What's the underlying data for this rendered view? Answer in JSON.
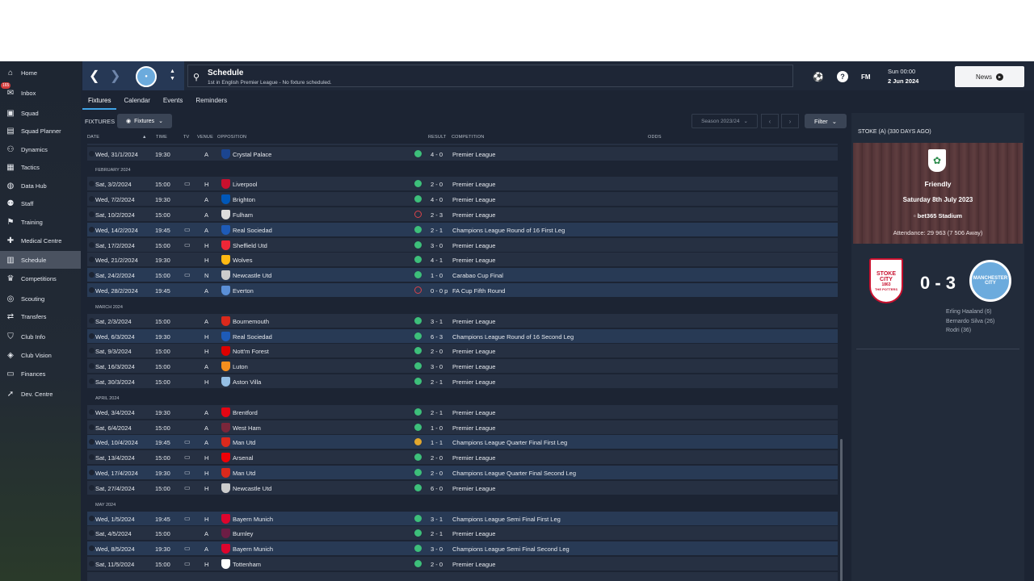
{
  "sidebar": {
    "items": [
      {
        "label": "Home",
        "icon": "home-icon"
      },
      {
        "label": "Inbox",
        "icon": "inbox-icon",
        "badge": "165"
      },
      {
        "label": "Squad",
        "icon": "shirt-icon"
      },
      {
        "label": "Squad Planner",
        "icon": "planner-icon"
      },
      {
        "label": "Dynamics",
        "icon": "dynamics-icon"
      },
      {
        "label": "Tactics",
        "icon": "tactics-icon"
      },
      {
        "label": "Data Hub",
        "icon": "data-hub-icon"
      },
      {
        "label": "Staff",
        "icon": "staff-icon"
      },
      {
        "label": "Training",
        "icon": "training-icon"
      },
      {
        "label": "Medical Centre",
        "icon": "medical-icon"
      },
      {
        "label": "Schedule",
        "icon": "calendar-icon",
        "active": true
      },
      {
        "label": "Competitions",
        "icon": "trophy-icon"
      },
      {
        "label": "Scouting",
        "icon": "scouting-icon"
      },
      {
        "label": "Transfers",
        "icon": "transfers-icon"
      },
      {
        "label": "Club Info",
        "icon": "club-info-icon"
      },
      {
        "label": "Club Vision",
        "icon": "club-vision-icon"
      },
      {
        "label": "Finances",
        "icon": "finances-icon"
      },
      {
        "label": "Dev. Centre",
        "icon": "dev-centre-icon"
      }
    ]
  },
  "header": {
    "title": "Schedule",
    "subtitle": "1st in English Premier League - No fixture scheduled.",
    "fm": "FM",
    "date_day": "Sun 00:00",
    "date_full": "2 Jun 2024",
    "news": "News"
  },
  "tabs": [
    "Fixtures",
    "Calendar",
    "Events",
    "Reminders"
  ],
  "toolbar": {
    "label": "FIXTURES",
    "view": "Fixtures",
    "season": "Season 2023/24",
    "filter": "Filter"
  },
  "columns": [
    "DATE",
    "TIME",
    "TV",
    "VENUE",
    "OPPOSITION",
    "RESULT",
    "COMPETITION",
    "ODDS"
  ],
  "colors": {
    "win": "#3dbf7a",
    "loss": "#d8434a",
    "draw": "#e2a72e",
    "accent": "#3fa3e6"
  },
  "fixtures": [
    {
      "type": "match",
      "date": "Wed, 31/1/2024",
      "time": "19:30",
      "tv": false,
      "venue": "A",
      "opp": "Crystal Palace",
      "crest": "#1b458f",
      "result": "4 - 0",
      "outcome": "win",
      "comp": "Premier League",
      "alt": false
    },
    {
      "type": "month",
      "label": "FEBRUARY 2024"
    },
    {
      "type": "match",
      "date": "Sat, 3/2/2024",
      "time": "15:00",
      "tv": true,
      "venue": "H",
      "opp": "Liverpool",
      "crest": "#c8102e",
      "result": "2 - 0",
      "outcome": "win",
      "comp": "Premier League",
      "alt": false
    },
    {
      "type": "match",
      "date": "Wed, 7/2/2024",
      "time": "19:30",
      "tv": false,
      "venue": "A",
      "opp": "Brighton",
      "crest": "#0057b8",
      "result": "4 - 0",
      "outcome": "win",
      "comp": "Premier League",
      "alt": false
    },
    {
      "type": "match",
      "date": "Sat, 10/2/2024",
      "time": "15:00",
      "tv": false,
      "venue": "A",
      "opp": "Fulham",
      "crest": "#dddddd",
      "result": "2 - 3",
      "outcome": "loss",
      "comp": "Premier League",
      "alt": false
    },
    {
      "type": "match",
      "date": "Wed, 14/2/2024",
      "time": "19:45",
      "tv": true,
      "venue": "A",
      "opp": "Real Sociedad",
      "crest": "#1e5bb8",
      "result": "2 - 1",
      "outcome": "win",
      "comp": "Champions League Round of 16  First Leg",
      "alt": true
    },
    {
      "type": "match",
      "date": "Sat, 17/2/2024",
      "time": "15:00",
      "tv": true,
      "venue": "H",
      "opp": "Sheffield Utd",
      "crest": "#ee2737",
      "result": "3 - 0",
      "outcome": "win",
      "comp": "Premier League",
      "alt": false
    },
    {
      "type": "match",
      "date": "Wed, 21/2/2024",
      "time": "19:30",
      "tv": false,
      "venue": "H",
      "opp": "Wolves",
      "crest": "#fdb913",
      "result": "4 - 1",
      "outcome": "win",
      "comp": "Premier League",
      "alt": false
    },
    {
      "type": "match",
      "date": "Sat, 24/2/2024",
      "time": "15:00",
      "tv": true,
      "venue": "N",
      "opp": "Newcastle Utd",
      "crest": "#cccccc",
      "result": "1 - 0",
      "outcome": "win",
      "comp": "Carabao Cup Final",
      "alt": true
    },
    {
      "type": "match",
      "date": "Wed, 28/2/2024",
      "time": "19:45",
      "tv": false,
      "venue": "A",
      "opp": "Everton",
      "crest": "#5b8fd6",
      "result": "0 - 0 p",
      "outcome": "loss",
      "comp": "FA Cup Fifth Round",
      "alt": true
    },
    {
      "type": "month",
      "label": "MARCH 2024"
    },
    {
      "type": "match",
      "date": "Sat, 2/3/2024",
      "time": "15:00",
      "tv": false,
      "venue": "A",
      "opp": "Bournemouth",
      "crest": "#da291c",
      "result": "3 - 1",
      "outcome": "win",
      "comp": "Premier League",
      "alt": false
    },
    {
      "type": "match",
      "date": "Wed, 6/3/2024",
      "time": "19:30",
      "tv": false,
      "venue": "H",
      "opp": "Real Sociedad",
      "crest": "#1e5bb8",
      "result": "6 - 3",
      "outcome": "win",
      "comp": "Champions League Round of 16  Second Leg",
      "alt": true
    },
    {
      "type": "match",
      "date": "Sat, 9/3/2024",
      "time": "15:00",
      "tv": false,
      "venue": "H",
      "opp": "Nott'm Forest",
      "crest": "#dd0000",
      "result": "2 - 0",
      "outcome": "win",
      "comp": "Premier League",
      "alt": false
    },
    {
      "type": "match",
      "date": "Sat, 16/3/2024",
      "time": "15:00",
      "tv": false,
      "venue": "A",
      "opp": "Luton",
      "crest": "#f78f1e",
      "result": "3 - 0",
      "outcome": "win",
      "comp": "Premier League",
      "alt": false
    },
    {
      "type": "match",
      "date": "Sat, 30/3/2024",
      "time": "15:00",
      "tv": false,
      "venue": "H",
      "opp": "Aston Villa",
      "crest": "#95bfe5",
      "result": "2 - 1",
      "outcome": "win",
      "comp": "Premier League",
      "alt": false
    },
    {
      "type": "month",
      "label": "APRIL 2024"
    },
    {
      "type": "match",
      "date": "Wed, 3/4/2024",
      "time": "19:30",
      "tv": false,
      "venue": "A",
      "opp": "Brentford",
      "crest": "#e30613",
      "result": "2 - 1",
      "outcome": "win",
      "comp": "Premier League",
      "alt": false
    },
    {
      "type": "match",
      "date": "Sat, 6/4/2024",
      "time": "15:00",
      "tv": false,
      "venue": "A",
      "opp": "West Ham",
      "crest": "#7a263a",
      "result": "1 - 0",
      "outcome": "win",
      "comp": "Premier League",
      "alt": false
    },
    {
      "type": "match",
      "date": "Wed, 10/4/2024",
      "time": "19:45",
      "tv": true,
      "venue": "A",
      "opp": "Man Utd",
      "crest": "#da291c",
      "result": "1 - 1",
      "outcome": "draw",
      "comp": "Champions League Quarter Final First Leg",
      "alt": true
    },
    {
      "type": "match",
      "date": "Sat, 13/4/2024",
      "time": "15:00",
      "tv": true,
      "venue": "H",
      "opp": "Arsenal",
      "crest": "#ef0107",
      "result": "2 - 0",
      "outcome": "win",
      "comp": "Premier League",
      "alt": false
    },
    {
      "type": "match",
      "date": "Wed, 17/4/2024",
      "time": "19:30",
      "tv": true,
      "venue": "H",
      "opp": "Man Utd",
      "crest": "#da291c",
      "result": "2 - 0",
      "outcome": "win",
      "comp": "Champions League Quarter Final Second Leg",
      "alt": true
    },
    {
      "type": "match",
      "date": "Sat, 27/4/2024",
      "time": "15:00",
      "tv": true,
      "venue": "H",
      "opp": "Newcastle Utd",
      "crest": "#cccccc",
      "result": "6 - 0",
      "outcome": "win",
      "comp": "Premier League",
      "alt": false
    },
    {
      "type": "month",
      "label": "MAY 2024"
    },
    {
      "type": "match",
      "date": "Wed, 1/5/2024",
      "time": "19:45",
      "tv": true,
      "venue": "H",
      "opp": "Bayern Munich",
      "crest": "#dc052d",
      "result": "3 - 1",
      "outcome": "win",
      "comp": "Champions League Semi Final First Leg",
      "alt": true
    },
    {
      "type": "match",
      "date": "Sat, 4/5/2024",
      "time": "15:00",
      "tv": false,
      "venue": "A",
      "opp": "Burnley",
      "crest": "#6c1d45",
      "result": "2 - 1",
      "outcome": "win",
      "comp": "Premier League",
      "alt": false
    },
    {
      "type": "match",
      "date": "Wed, 8/5/2024",
      "time": "19:30",
      "tv": true,
      "venue": "A",
      "opp": "Bayern Munich",
      "crest": "#dc052d",
      "result": "3 - 0",
      "outcome": "win",
      "comp": "Champions League Semi Final Second Leg",
      "alt": true
    },
    {
      "type": "match",
      "date": "Sat, 11/5/2024",
      "time": "15:00",
      "tv": true,
      "venue": "H",
      "opp": "Tottenham",
      "crest": "#ffffff",
      "result": "2 - 0",
      "outcome": "win",
      "comp": "Premier League",
      "alt": false
    }
  ],
  "panel": {
    "title": "STOKE (A) (330 DAYS AGO)",
    "match_type": "Friendly",
    "match_date": "Saturday 8th July 2023",
    "venue": "bet365 Stadium",
    "attendance": "Attendance: 29 963 (7 506 Away)",
    "score": "0 - 3",
    "home_crest_top": "STOKE",
    "home_crest_mid": "CITY",
    "home_crest_year": "1863",
    "home_crest_bottom": "THE POTTERS",
    "away_crest_top": "MANCHESTER",
    "away_crest_bottom": "CITY",
    "scorers": [
      "Erling Haaland (6)",
      "Bernardo Silva (26)",
      "Rodri (36)"
    ]
  }
}
